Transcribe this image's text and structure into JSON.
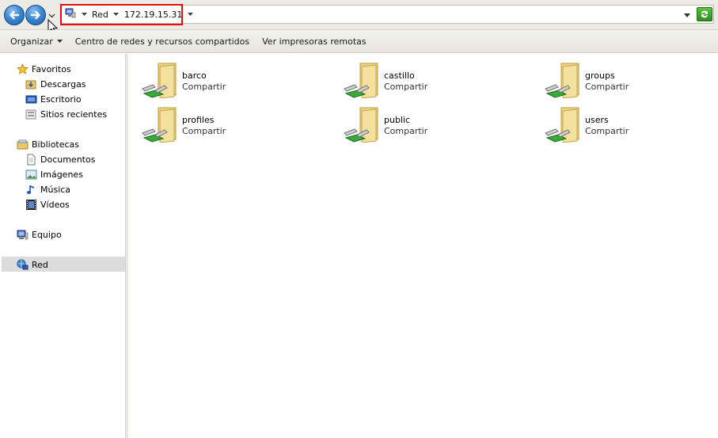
{
  "address_bar": {
    "breadcrumbs": [
      "Red",
      "172.19.15.31"
    ]
  },
  "commands": [
    "Organizar",
    "Centro de redes y recursos compartidos",
    "Ver impresoras remotas"
  ],
  "nav": {
    "favorites": "Favoritos",
    "favorites_items": [
      "Descargas",
      "Escritorio",
      "Sitios recientes"
    ],
    "libraries": "Bibliotecas",
    "libraries_items": [
      "Documentos",
      "Imágenes",
      "Música",
      "Vídeos"
    ],
    "computer": "Equipo",
    "network": "Red"
  },
  "shares": [
    {
      "name": "barco",
      "type": "Compartir"
    },
    {
      "name": "castillo",
      "type": "Compartir"
    },
    {
      "name": "groups",
      "type": "Compartir"
    },
    {
      "name": "profiles",
      "type": "Compartir"
    },
    {
      "name": "public",
      "type": "Compartir"
    },
    {
      "name": "users",
      "type": "Compartir"
    }
  ]
}
